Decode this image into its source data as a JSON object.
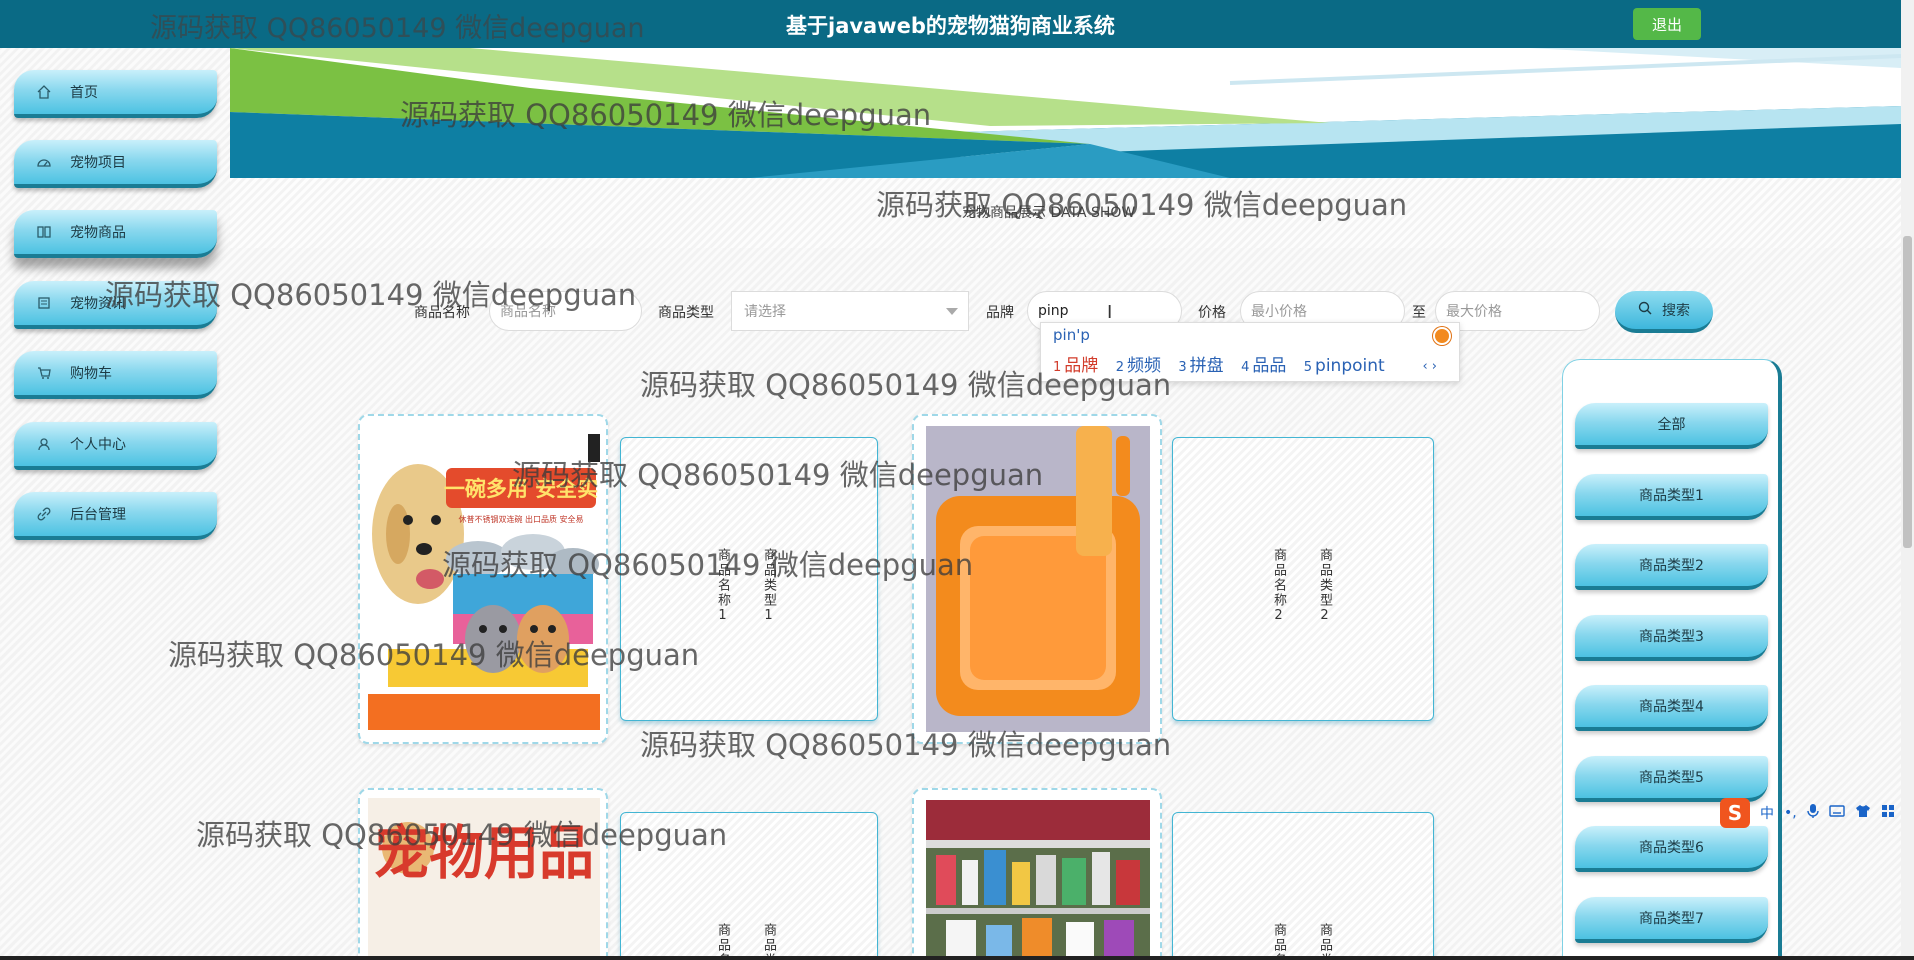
{
  "header": {
    "title": "基于javaweb的宠物猫狗商业系统",
    "logout_label": "退出"
  },
  "sidebar": {
    "items": [
      {
        "label": "首页",
        "icon": "home-icon"
      },
      {
        "label": "宠物项目",
        "icon": "dashboard-icon"
      },
      {
        "label": "宠物商品",
        "icon": "columns-icon"
      },
      {
        "label": "宠物资讯",
        "icon": "news-icon"
      },
      {
        "label": "购物车",
        "icon": "cart-icon"
      },
      {
        "label": "个人中心",
        "icon": "user-icon"
      },
      {
        "label": "后台管理",
        "icon": "link-icon"
      }
    ],
    "active_index": 2
  },
  "section": {
    "title": "宠物商品展示 DATA SHOW"
  },
  "search": {
    "name_label": "商品名称",
    "name_placeholder": "商品名称",
    "type_label": "商品类型",
    "type_placeholder": "请选择",
    "brand_label": "品牌",
    "brand_value": "pinp",
    "price_label": "价格",
    "min_placeholder": "最小价格",
    "to_label": "至",
    "max_placeholder": "最大价格",
    "button_label": "搜索"
  },
  "ime": {
    "composition": "pin'p",
    "candidates": [
      {
        "n": "1",
        "text": "品牌"
      },
      {
        "n": "2",
        "text": "频频"
      },
      {
        "n": "3",
        "text": "拼盘"
      },
      {
        "n": "4",
        "text": "品品"
      },
      {
        "n": "5",
        "text": "pinpoint"
      }
    ],
    "pager": "‹ ›"
  },
  "products": {
    "row1": [
      {
        "kind": "image",
        "image": "dog-bowls-photo",
        "banner_text": "一碗多用 安全实",
        "sub_text": "休普不锈钢双连碗 出口品质 安全易"
      },
      {
        "kind": "text",
        "name": "商品名称1",
        "type": "商品类型1"
      },
      {
        "kind": "image",
        "image": "cat-litter-box-photo"
      },
      {
        "kind": "text",
        "name": "商品名称2",
        "type": "商品类型2"
      }
    ],
    "row2": [
      {
        "kind": "image",
        "image": "pet-supplies-poster",
        "poster_text": "宠物用品"
      },
      {
        "kind": "text",
        "name": "商品名称",
        "type": "商品类型"
      },
      {
        "kind": "image",
        "image": "pet-store-shelves-photo"
      },
      {
        "kind": "text",
        "name": "商品名称",
        "type": "商品类型"
      }
    ]
  },
  "categories": [
    "全部",
    "商品类型1",
    "商品类型2",
    "商品类型3",
    "商品类型4",
    "商品类型5",
    "商品类型6",
    "商品类型7"
  ],
  "watermark": "源码获取 QQ86050149 微信deepguan",
  "sogou_bar": {
    "mode": "中",
    "punct": "•,"
  },
  "colors": {
    "header_bg": "#0a6a85",
    "logout_bg": "#54b848",
    "accent": "#3db7dc",
    "accent_dark": "#1a7c94"
  }
}
